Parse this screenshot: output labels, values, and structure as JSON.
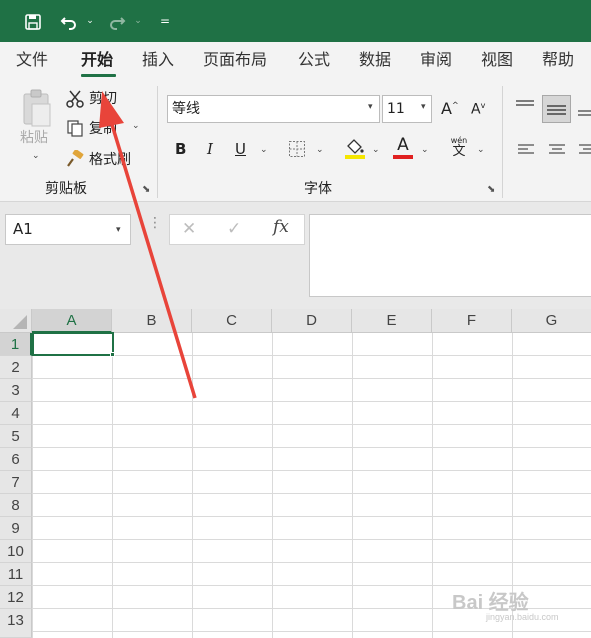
{
  "ribbon_tabs": [
    "文件",
    "开始",
    "插入",
    "页面布局",
    "公式",
    "数据",
    "审阅",
    "视图",
    "帮助"
  ],
  "clipboard": {
    "paste_label": "粘贴",
    "cut_label": "剪切",
    "copy_label": "复制",
    "format_painter_label": "格式刷",
    "group_label": "剪贴板"
  },
  "font": {
    "name": "等线",
    "size": "11",
    "bold": "B",
    "italic": "I",
    "underline": "U",
    "phonetic_top": "wén",
    "phonetic_bottom": "文",
    "color_glyph": "A",
    "fill_color": "#f5e600",
    "font_color": "#e02020",
    "group_label": "字体"
  },
  "formula_bar": {
    "name_box": "A1",
    "cancel": "✕",
    "enter": "✓",
    "fx": "fx"
  },
  "grid": {
    "columns": [
      "A",
      "B",
      "C",
      "D",
      "E",
      "F",
      "G"
    ],
    "rows": [
      "1",
      "2",
      "3",
      "4",
      "5",
      "6",
      "7",
      "8",
      "9",
      "10",
      "11",
      "12",
      "13"
    ],
    "active_cell": "A1"
  },
  "watermark": {
    "main": "Bai 经验",
    "sub": "jingyan.baidu.com"
  },
  "colors": {
    "accent": "#1f7145",
    "annotation_arrow": "#e8443a"
  }
}
